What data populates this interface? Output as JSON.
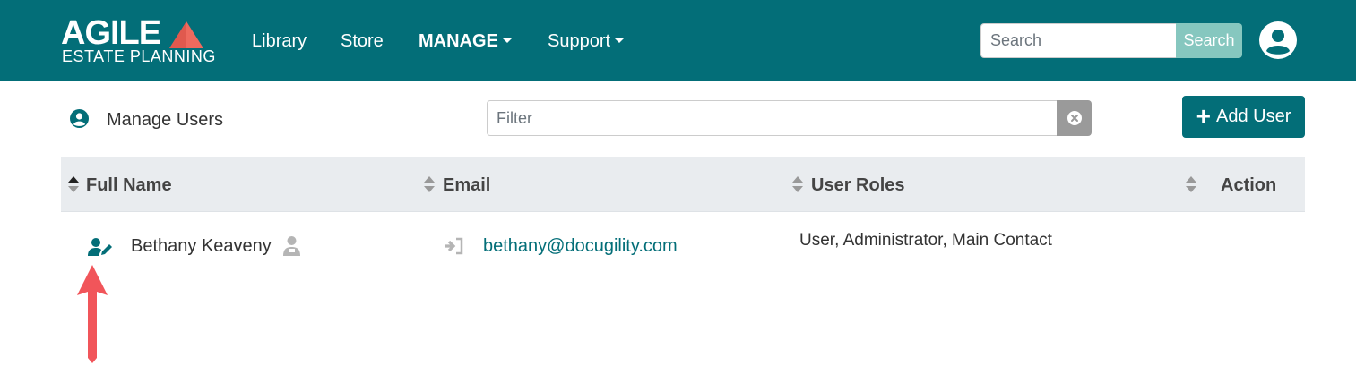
{
  "brand": {
    "logo_main": "AGILE",
    "logo_sub": "ESTATE PLANNING"
  },
  "nav": [
    {
      "label": "Library"
    },
    {
      "label": "Store"
    },
    {
      "label": "MANAGE"
    },
    {
      "label": "Support"
    }
  ],
  "search": {
    "placeholder": "Search",
    "button_label": "Search"
  },
  "toolbar": {
    "title": "Manage Users",
    "filter_placeholder": "Filter",
    "add_button_label": "Add User"
  },
  "table": {
    "columns": [
      "Full Name",
      "Email",
      "User Roles",
      "Action"
    ],
    "rows": [
      {
        "full_name": "Bethany Keaveny",
        "email": "bethany@docugility.com",
        "roles": "User, Administrator, Main Contact"
      }
    ]
  },
  "icons": {
    "user_circle": "user-circle-icon",
    "edit_user": "user-edit-icon",
    "main_contact": "user-tie-icon",
    "login_as": "sign-in-icon",
    "clear": "times-circle-icon"
  },
  "colors": {
    "primary": "#036e78",
    "search_button": "#86c7bf",
    "table_header_bg": "#e9ecef",
    "annotation_arrow": "#f1555a"
  }
}
